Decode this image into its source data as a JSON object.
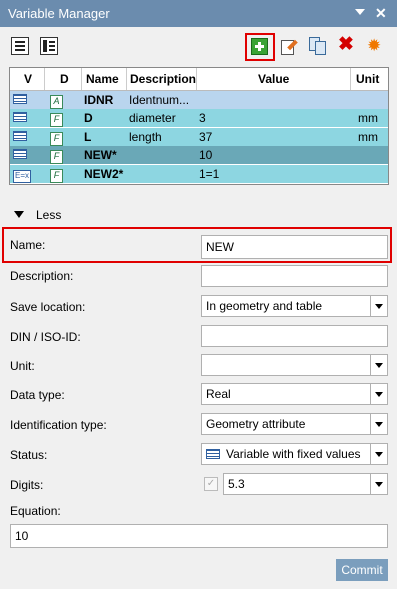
{
  "window": {
    "title": "Variable Manager"
  },
  "grid": {
    "columns": {
      "v": "V",
      "d": "D",
      "name": "Name",
      "description": "Description",
      "value": "Value",
      "unit": "Unit"
    },
    "rows": [
      {
        "v_icon": "table-icon",
        "d_type": "A",
        "name": "IDNR",
        "description": "Identnum...",
        "value": "",
        "unit": "",
        "bg": "#b9d5ee"
      },
      {
        "v_icon": "table-icon",
        "d_type": "F",
        "name": "D",
        "description": "diameter",
        "value": "3",
        "unit": "mm",
        "bg": "#8dd6e1"
      },
      {
        "v_icon": "table-icon",
        "d_type": "F",
        "name": "L",
        "description": "length",
        "value": "37",
        "unit": "mm",
        "bg": "#8dd6e1"
      },
      {
        "v_icon": "table-icon",
        "d_type": "F",
        "name": "NEW*",
        "description": "",
        "value": "10",
        "unit": "",
        "bg": "#6aa8b7"
      },
      {
        "v_icon": "formula-icon",
        "v_text": "E=x",
        "d_type": "F",
        "name": "NEW2*",
        "description": "",
        "value": "1=1",
        "unit": "",
        "bg": "#8dd6e1"
      }
    ]
  },
  "toggle": {
    "label": "Less"
  },
  "form": {
    "name": {
      "label": "Name:",
      "value": "NEW"
    },
    "description": {
      "label": "Description:",
      "value": ""
    },
    "save_location": {
      "label": "Save location:",
      "value": "In geometry and table"
    },
    "din": {
      "label": "DIN / ISO-ID:",
      "value": ""
    },
    "unit": {
      "label": "Unit:",
      "value": ""
    },
    "data_type": {
      "label": "Data type:",
      "value": "Real"
    },
    "identification_type": {
      "label": "Identification type:",
      "value": "Geometry attribute"
    },
    "status": {
      "label": "Status:",
      "value": "Variable with fixed values"
    },
    "digits": {
      "label": "Digits:",
      "value": "5.3",
      "checkbox": "✓"
    },
    "equation": {
      "label": "Equation:",
      "value": "10"
    }
  },
  "buttons": {
    "commit": "Commit"
  },
  "colors": {
    "title_bar": "#6b8cae",
    "highlight_frame": "#e00000",
    "commit": "#7b9ebd"
  }
}
